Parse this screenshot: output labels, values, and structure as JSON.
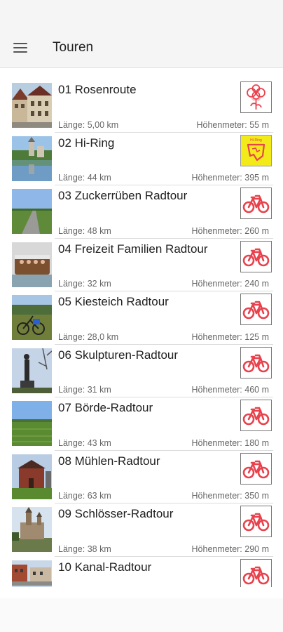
{
  "app": {
    "title": "Touren"
  },
  "tours": [
    {
      "name": "01 Rosenroute",
      "length": "Länge: 5,00 km",
      "elevation": "Höhenmeter: 55 m",
      "badge": "rose-icon",
      "thumb": "town"
    },
    {
      "name": "02 Hi-Ring",
      "length": "Länge: 44 km",
      "elevation": "Höhenmeter: 395 m",
      "badge": "hi-ring-icon",
      "badge_label": "Hi-Ring",
      "thumb": "lake"
    },
    {
      "name": "03 Zuckerrüben Radtour",
      "length": "Länge: 48 km",
      "elevation": "Höhenmeter: 260 m",
      "badge": "bicycle-icon",
      "thumb": "road"
    },
    {
      "name": "04 Freizeit Familien Radtour",
      "length": "Länge: 32 km",
      "elevation": "Höhenmeter: 240 m",
      "badge": "bicycle-icon",
      "thumb": "boat"
    },
    {
      "name": "05 Kiesteich Radtour",
      "length": "Länge: 28,0 km",
      "elevation": "Höhenmeter: 125 m",
      "badge": "bicycle-icon",
      "thumb": "bike"
    },
    {
      "name": "06 Skulpturen-Radtour",
      "length": "Länge: 31 km",
      "elevation": "Höhenmeter: 460 m",
      "badge": "bicycle-icon",
      "thumb": "sculpture"
    },
    {
      "name": "07 Börde-Radtour",
      "length": "Länge: 43 km",
      "elevation": "Höhenmeter: 180 m",
      "badge": "bicycle-icon",
      "thumb": "field"
    },
    {
      "name": "08 Mühlen-Radtour",
      "length": "Länge: 63 km",
      "elevation": "Höhenmeter: 350 m",
      "badge": "bicycle-icon",
      "thumb": "mill"
    },
    {
      "name": "09 Schlösser-Radtour",
      "length": "Länge: 38 km",
      "elevation": "Höhenmeter: 290 m",
      "badge": "bicycle-icon",
      "thumb": "castle"
    },
    {
      "name": "10 Kanal-Radtour",
      "length": "",
      "elevation": "",
      "badge": "bicycle-icon",
      "thumb": "canal"
    }
  ],
  "colors": {
    "bike_icon": "#e8424d",
    "hi_ring_bg": "#f3ea1a"
  }
}
